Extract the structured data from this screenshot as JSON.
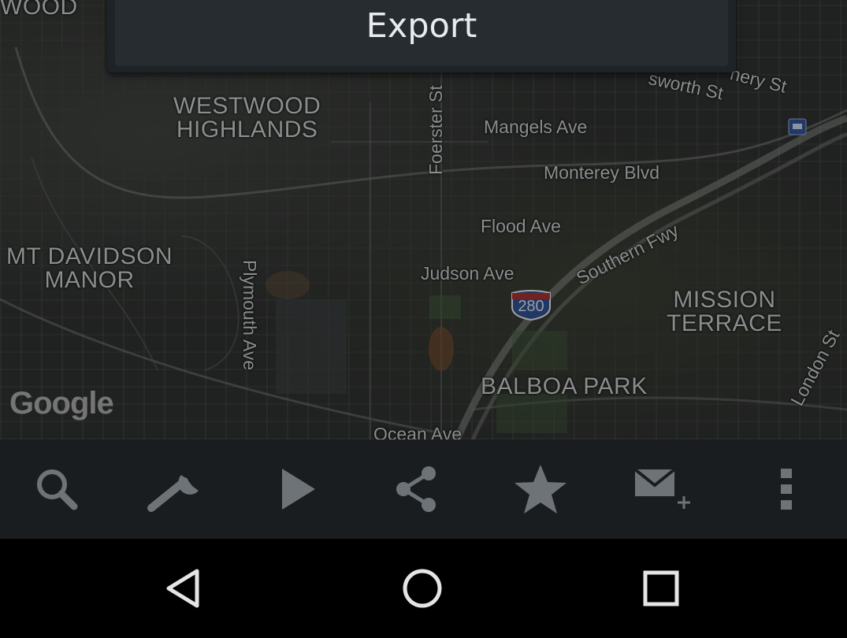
{
  "dialog": {
    "export_label": "Export"
  },
  "map": {
    "areas": {
      "westwood_highlands": "WESTWOOD\nHIGHLANDS",
      "mt_davidson_manor": "MT DAVIDSON\nMANOR",
      "mission_terrace": "MISSION\nTERRACE",
      "balboa_park": "BALBOA PARK",
      "westwood_partial": "WOOD"
    },
    "streets": {
      "mangels": "Mangels Ave",
      "monterey": "Monterey Blvd",
      "flood": "Flood Ave",
      "judson": "Judson Ave",
      "southern_fwy": "Southern Fwy",
      "ocean": "Ocean Ave",
      "foerster": "Foerster St",
      "plymouth": "Plymouth Ave",
      "london": "London St",
      "hosworth": "sworth St",
      "nery": "nery St"
    },
    "highway_shield": "280",
    "attribution": "Google"
  },
  "toolbar": {
    "items": [
      "search-icon",
      "wrench-icon",
      "play-icon",
      "share-icon",
      "star-icon",
      "add-mail-icon",
      "overflow-menu-icon"
    ]
  },
  "navbar": {
    "items": [
      "back-icon",
      "home-icon",
      "recents-icon"
    ]
  },
  "colors": {
    "toolbar_icon": "#6e7377",
    "nav_icon": "#e5e5e5",
    "dialog_bg": "#272c31"
  }
}
